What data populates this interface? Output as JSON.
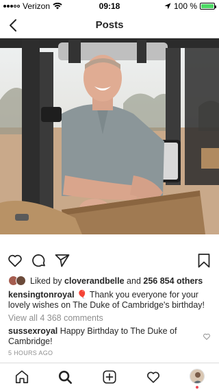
{
  "status": {
    "carrier": "Verizon",
    "time": "09:18",
    "battery": "100 %",
    "battery_level": 1.0
  },
  "nav": {
    "title": "Posts"
  },
  "post": {
    "likes": {
      "prefix": "Liked by ",
      "user": "cloverandbelle",
      "middle": " and ",
      "count": "256 854 others"
    },
    "caption": {
      "user": "kensingtonroyal",
      "text": " 🎈  Thank you everyone for your lovely wishes on The Duke of Cambridge's birthday!"
    },
    "view_comments": "View all 4 368 comments",
    "comment": {
      "user": "sussexroyal",
      "text": " Happy Birthday to The Duke of Cambridge!"
    },
    "timestamp": "5 HOURS AGO"
  },
  "colors": {
    "text": "#262626",
    "muted": "#8e8e8e",
    "divider": "#dbdbdb",
    "battery": "#4cd964",
    "notification": "#ed4956"
  }
}
